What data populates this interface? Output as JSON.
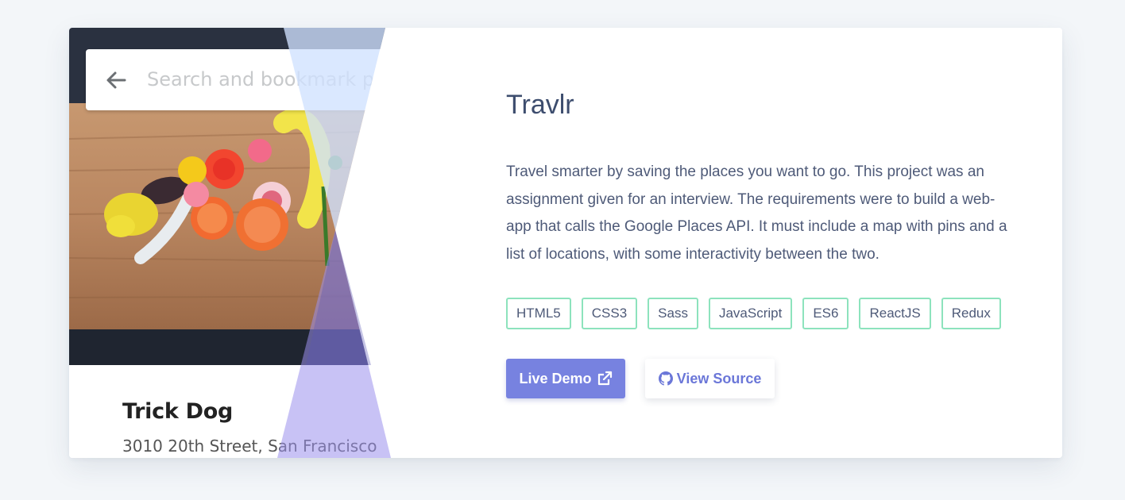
{
  "project": {
    "title": "Travlr",
    "description": "Travel smarter by saving the places you want to go. This project was an assignment given for an interview. The requirements were to build a web-app that calls the Google Places API. It must include a map with pins and a list of locations, with some interactivity between the two.",
    "tags": [
      "HTML5",
      "CSS3",
      "Sass",
      "JavaScript",
      "ES6",
      "ReactJS",
      "Redux"
    ],
    "live_demo_label": "Live Demo",
    "view_source_label": "View Source"
  },
  "screenshot": {
    "search_placeholder": "Search and bookmark plac",
    "place_name": "Trick Dog",
    "place_address": "3010 20th Street, San Francisco"
  },
  "colors": {
    "accent": "#7782e0",
    "tag_border": "#8de3bd",
    "title": "#3d4d6e",
    "overlay_top": "#c9defb",
    "overlay_bottom": "#a99ef0"
  },
  "icons": {
    "back": "arrow-left-icon",
    "external": "external-link-icon",
    "github": "github-icon"
  }
}
